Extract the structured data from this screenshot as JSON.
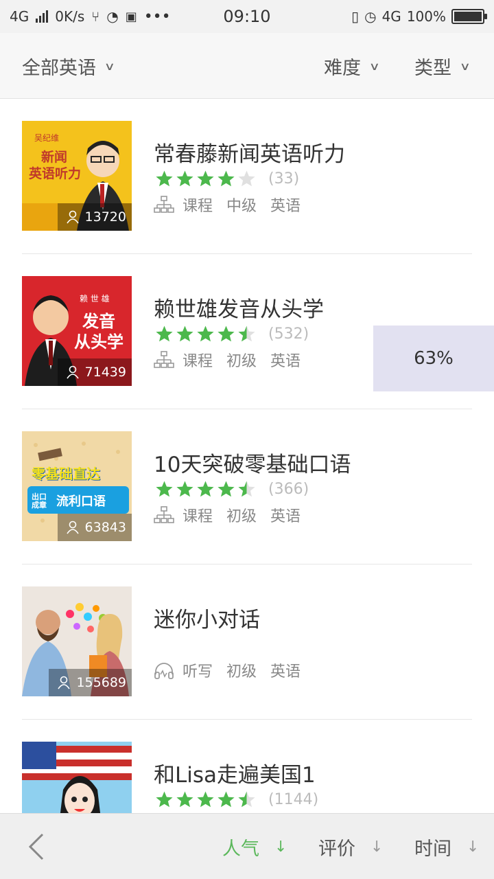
{
  "status_bar": {
    "network": "4G",
    "speed": "0K/s",
    "time": "09:10",
    "network_right": "4G",
    "battery": "100%"
  },
  "filters": {
    "all": "全部英语",
    "difficulty": "难度",
    "type": "类型"
  },
  "courses": [
    {
      "title": "常春藤新闻英语听力",
      "rating": 4,
      "rating_count": "(33)",
      "learners": "13720",
      "category_icon": "course-tree-icon",
      "category": "课程",
      "level": "中级",
      "language": "英语",
      "thumb_text_top": "吴纪维",
      "thumb_text_1": "新闻",
      "thumb_text_2": "英语听力"
    },
    {
      "title": "赖世雄发音从头学",
      "rating": 4.5,
      "rating_count": "(532)",
      "learners": "71439",
      "category_icon": "course-tree-icon",
      "category": "课程",
      "level": "初级",
      "language": "英语",
      "thumb_text_top": "赖 世 雄",
      "thumb_text_1": "发音",
      "thumb_text_2": "从头学"
    },
    {
      "title": "10天突破零基础口语",
      "rating": 4.5,
      "rating_count": "(366)",
      "learners": "63843",
      "category_icon": "course-tree-icon",
      "category": "课程",
      "level": "初级",
      "language": "英语",
      "thumb_text_top": "零基础直达",
      "thumb_text_1": "出口成章",
      "thumb_text_2": "流利口语"
    },
    {
      "title": "迷你小对话",
      "rating": null,
      "rating_count": "",
      "learners": "155689",
      "category_icon": "headphone-icon",
      "category": "听写",
      "level": "初级",
      "language": "英语"
    },
    {
      "title": "和Lisa走遍美国1",
      "rating": 4.5,
      "rating_count": "(1144)",
      "learners": "",
      "category_icon": "course-tree-icon",
      "category": "",
      "level": "",
      "language": ""
    }
  ],
  "progress_badge": "63%",
  "sort_bar": {
    "popularity": "人气",
    "rating": "评价",
    "time": "时间",
    "active": "popularity"
  },
  "colors": {
    "accent_green": "#4cb84c",
    "star_empty": "#e0e0e0"
  }
}
